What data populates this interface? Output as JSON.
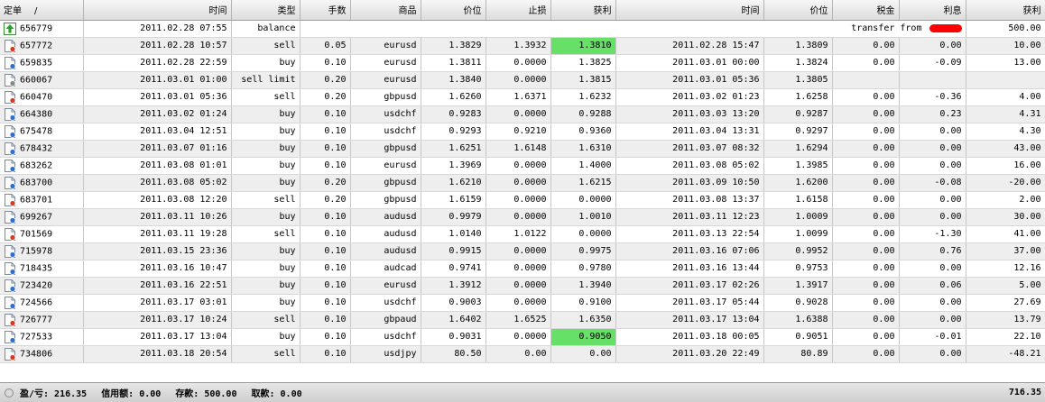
{
  "columns": [
    "定单",
    "时间",
    "类型",
    "手数",
    "商品",
    "价位",
    "止损",
    "获利",
    "时间",
    "价位",
    "税金",
    "利息",
    "获利"
  ],
  "sort_indicator": "/",
  "rows": [
    {
      "ticket": "656779",
      "open_time": "2011.02.28 07:55",
      "type": "balance",
      "comment": "transfer from ",
      "profit": "500.00",
      "icon": "deposit-icon"
    },
    {
      "ticket": "657772",
      "open_time": "2011.02.28 10:57",
      "type": "sell",
      "lots": "0.05",
      "symbol": "eurusd",
      "open_price": "1.3829",
      "sl": "1.3932",
      "tp": "1.3810",
      "close_time": "2011.02.28 15:47",
      "close_price": "1.3809",
      "tax": "0.00",
      "swap": "0.00",
      "profit": "10.00",
      "tp_hl": true,
      "icon": "sell-order-icon"
    },
    {
      "ticket": "659835",
      "open_time": "2011.02.28 22:59",
      "type": "buy",
      "lots": "0.10",
      "symbol": "eurusd",
      "open_price": "1.3811",
      "sl": "0.0000",
      "tp": "1.3825",
      "close_time": "2011.03.01 00:00",
      "close_price": "1.3824",
      "tax": "0.00",
      "swap": "-0.09",
      "profit": "13.00",
      "icon": "buy-order-icon"
    },
    {
      "ticket": "660067",
      "open_time": "2011.03.01 01:00",
      "type": "sell limit",
      "lots": "0.20",
      "symbol": "eurusd",
      "open_price": "1.3840",
      "sl": "0.0000",
      "tp": "1.3815",
      "close_time": "2011.03.01 05:36",
      "close_price": "1.3805",
      "tax": "",
      "swap": "",
      "profit": "",
      "icon": "pending-order-icon"
    },
    {
      "ticket": "660470",
      "open_time": "2011.03.01 05:36",
      "type": "sell",
      "lots": "0.20",
      "symbol": "gbpusd",
      "open_price": "1.6260",
      "sl": "1.6371",
      "tp": "1.6232",
      "close_time": "2011.03.02 01:23",
      "close_price": "1.6258",
      "tax": "0.00",
      "swap": "-0.36",
      "profit": "4.00",
      "icon": "sell-order-icon"
    },
    {
      "ticket": "664380",
      "open_time": "2011.03.02 01:24",
      "type": "buy",
      "lots": "0.10",
      "symbol": "usdchf",
      "open_price": "0.9283",
      "sl": "0.0000",
      "tp": "0.9288",
      "close_time": "2011.03.03 13:20",
      "close_price": "0.9287",
      "tax": "0.00",
      "swap": "0.23",
      "profit": "4.31",
      "icon": "buy-order-icon"
    },
    {
      "ticket": "675478",
      "open_time": "2011.03.04 12:51",
      "type": "buy",
      "lots": "0.10",
      "symbol": "usdchf",
      "open_price": "0.9293",
      "sl": "0.9210",
      "tp": "0.9360",
      "close_time": "2011.03.04 13:31",
      "close_price": "0.9297",
      "tax": "0.00",
      "swap": "0.00",
      "profit": "4.30",
      "icon": "buy-order-icon"
    },
    {
      "ticket": "678432",
      "open_time": "2011.03.07 01:16",
      "type": "buy",
      "lots": "0.10",
      "symbol": "gbpusd",
      "open_price": "1.6251",
      "sl": "1.6148",
      "tp": "1.6310",
      "close_time": "2011.03.07 08:32",
      "close_price": "1.6294",
      "tax": "0.00",
      "swap": "0.00",
      "profit": "43.00",
      "icon": "buy-order-icon"
    },
    {
      "ticket": "683262",
      "open_time": "2011.03.08 01:01",
      "type": "buy",
      "lots": "0.10",
      "symbol": "eurusd",
      "open_price": "1.3969",
      "sl": "0.0000",
      "tp": "1.4000",
      "close_time": "2011.03.08 05:02",
      "close_price": "1.3985",
      "tax": "0.00",
      "swap": "0.00",
      "profit": "16.00",
      "icon": "buy-order-icon"
    },
    {
      "ticket": "683700",
      "open_time": "2011.03.08 05:02",
      "type": "buy",
      "lots": "0.20",
      "symbol": "gbpusd",
      "open_price": "1.6210",
      "sl": "0.0000",
      "tp": "1.6215",
      "close_time": "2011.03.09 10:50",
      "close_price": "1.6200",
      "tax": "0.00",
      "swap": "-0.08",
      "profit": "-20.00",
      "icon": "buy-order-icon"
    },
    {
      "ticket": "683701",
      "open_time": "2011.03.08 12:20",
      "type": "sell",
      "lots": "0.20",
      "symbol": "gbpusd",
      "open_price": "1.6159",
      "sl": "0.0000",
      "tp": "0.0000",
      "close_time": "2011.03.08 13:37",
      "close_price": "1.6158",
      "tax": "0.00",
      "swap": "0.00",
      "profit": "2.00",
      "icon": "sell-order-icon"
    },
    {
      "ticket": "699267",
      "open_time": "2011.03.11 10:26",
      "type": "buy",
      "lots": "0.10",
      "symbol": "audusd",
      "open_price": "0.9979",
      "sl": "0.0000",
      "tp": "1.0010",
      "close_time": "2011.03.11 12:23",
      "close_price": "1.0009",
      "tax": "0.00",
      "swap": "0.00",
      "profit": "30.00",
      "icon": "buy-order-icon"
    },
    {
      "ticket": "701569",
      "open_time": "2011.03.11 19:28",
      "type": "sell",
      "lots": "0.10",
      "symbol": "audusd",
      "open_price": "1.0140",
      "sl": "1.0122",
      "tp": "0.0000",
      "close_time": "2011.03.13 22:54",
      "close_price": "1.0099",
      "tax": "0.00",
      "swap": "-1.30",
      "profit": "41.00",
      "icon": "sell-order-icon"
    },
    {
      "ticket": "715978",
      "open_time": "2011.03.15 23:36",
      "type": "buy",
      "lots": "0.10",
      "symbol": "audusd",
      "open_price": "0.9915",
      "sl": "0.0000",
      "tp": "0.9975",
      "close_time": "2011.03.16 07:06",
      "close_price": "0.9952",
      "tax": "0.00",
      "swap": "0.76",
      "profit": "37.00",
      "icon": "buy-order-icon"
    },
    {
      "ticket": "718435",
      "open_time": "2011.03.16 10:47",
      "type": "buy",
      "lots": "0.10",
      "symbol": "audcad",
      "open_price": "0.9741",
      "sl": "0.0000",
      "tp": "0.9780",
      "close_time": "2011.03.16 13:44",
      "close_price": "0.9753",
      "tax": "0.00",
      "swap": "0.00",
      "profit": "12.16",
      "icon": "buy-order-icon"
    },
    {
      "ticket": "723420",
      "open_time": "2011.03.16 22:51",
      "type": "buy",
      "lots": "0.10",
      "symbol": "eurusd",
      "open_price": "1.3912",
      "sl": "0.0000",
      "tp": "1.3940",
      "close_time": "2011.03.17 02:26",
      "close_price": "1.3917",
      "tax": "0.00",
      "swap": "0.06",
      "profit": "5.00",
      "icon": "buy-order-icon"
    },
    {
      "ticket": "724566",
      "open_time": "2011.03.17 03:01",
      "type": "buy",
      "lots": "0.10",
      "symbol": "usdchf",
      "open_price": "0.9003",
      "sl": "0.0000",
      "tp": "0.9100",
      "close_time": "2011.03.17 05:44",
      "close_price": "0.9028",
      "tax": "0.00",
      "swap": "0.00",
      "profit": "27.69",
      "icon": "buy-order-icon"
    },
    {
      "ticket": "726777",
      "open_time": "2011.03.17 10:24",
      "type": "sell",
      "lots": "0.10",
      "symbol": "gbpaud",
      "open_price": "1.6402",
      "sl": "1.6525",
      "tp": "1.6350",
      "close_time": "2011.03.17 13:04",
      "close_price": "1.6388",
      "tax": "0.00",
      "swap": "0.00",
      "profit": "13.79",
      "icon": "sell-order-icon"
    },
    {
      "ticket": "727533",
      "open_time": "2011.03.17 13:04",
      "type": "buy",
      "lots": "0.10",
      "symbol": "usdchf",
      "open_price": "0.9031",
      "sl": "0.0000",
      "tp": "0.9050",
      "close_time": "2011.03.18 00:05",
      "close_price": "0.9051",
      "tax": "0.00",
      "swap": "-0.01",
      "profit": "22.10",
      "tp_hl": true,
      "icon": "buy-order-icon"
    },
    {
      "ticket": "734806",
      "open_time": "2011.03.18 20:54",
      "type": "sell",
      "lots": "0.10",
      "symbol": "usdjpy",
      "open_price": "80.50",
      "sl": "0.00",
      "tp": "0.00",
      "close_time": "2011.03.20 22:49",
      "close_price": "80.89",
      "tax": "0.00",
      "swap": "0.00",
      "profit": "-48.21",
      "icon": "sell-order-icon"
    }
  ],
  "summary": {
    "pnl": "盈/亏: 216.35",
    "credit": "信用额: 0.00",
    "deposit": "存款: 500.00",
    "withdrawal": "取款: 0.00",
    "total": "716.35"
  },
  "colors": {
    "highlight": "#66e066",
    "row_alt": "#eeeeee",
    "redaction": "#ff0000"
  }
}
